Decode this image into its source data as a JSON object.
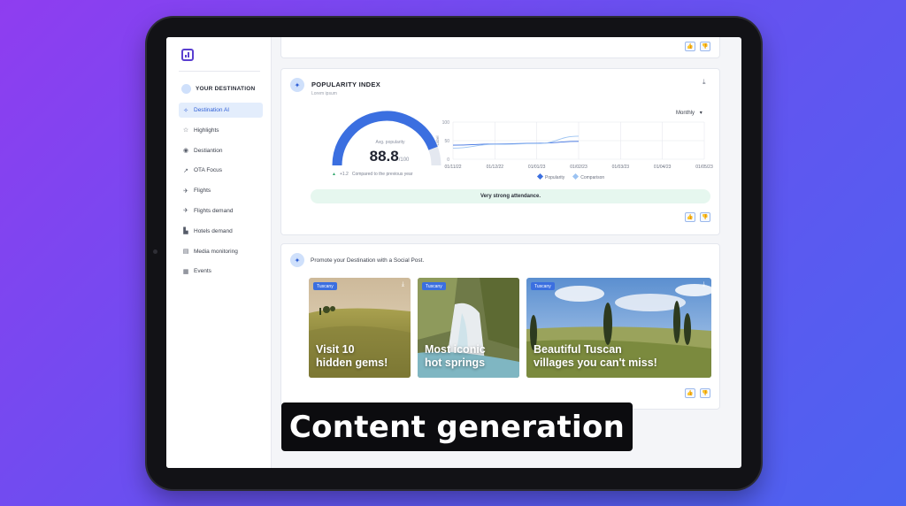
{
  "sidebar": {
    "section_title": "YOUR DESTINATION",
    "items": [
      {
        "label": "Destination AI",
        "icon": "sparkle-icon",
        "glyph": "✧",
        "active": true
      },
      {
        "label": "Highlights",
        "icon": "star-icon",
        "glyph": "☆",
        "active": false
      },
      {
        "label": "Destiantion",
        "icon": "target-icon",
        "glyph": "◉",
        "active": false
      },
      {
        "label": "OTA Focus",
        "icon": "trend-icon",
        "glyph": "↗",
        "active": false
      },
      {
        "label": "Flights",
        "icon": "plane-icon",
        "glyph": "✈",
        "active": false
      },
      {
        "label": "Flights demand",
        "icon": "plane-demand-icon",
        "glyph": "✈",
        "active": false
      },
      {
        "label": "Hotels demand",
        "icon": "hotel-icon",
        "glyph": "▙",
        "active": false
      },
      {
        "label": "Media monitoring",
        "icon": "newspaper-icon",
        "glyph": "▤",
        "active": false
      },
      {
        "label": "Events",
        "icon": "calendar-icon",
        "glyph": "▦",
        "active": false
      }
    ]
  },
  "popularity": {
    "title": "POPULARITY INDEX",
    "subtitle": "Lorem ipsum",
    "gauge_caption": "Avg. popularity",
    "value": "88.8",
    "value_suffix": "/100",
    "gauge_level": 0.888,
    "compare_delta": "+1.2",
    "compare_text": "Compared to the previous year",
    "period_select": "Monthly",
    "banner": "Very strong attendance.",
    "accent": "#3b6fe0"
  },
  "promo": {
    "text": "Promote your Destination with a Social Post.",
    "posts": [
      {
        "tag": "Tuscany",
        "headline": "Visit 10\nhidden gems!"
      },
      {
        "tag": "Tuscany",
        "headline": "Most iconic\nhot springs"
      },
      {
        "tag": "Tuscany",
        "headline": "Beautiful Tuscan\nvillages you can't miss!"
      }
    ]
  },
  "caption": "Content generation",
  "chart_data": {
    "type": "line",
    "title": "",
    "xlabel": "",
    "ylabel": "Label",
    "ylim": [
      0,
      100
    ],
    "yticks": [
      "100",
      "50",
      "0"
    ],
    "categories": [
      "01/11/22",
      "01/12/22",
      "01/01/23",
      "01/02/23",
      "01/03/23",
      "01/04/23",
      "01/05/23"
    ],
    "series": [
      {
        "name": "Popularity",
        "color": "#3b6fe0",
        "values": [
          38,
          41,
          43,
          48,
          null,
          null,
          null
        ]
      },
      {
        "name": "Comparison",
        "color": "#9cc3f2",
        "values": [
          30,
          40,
          42,
          62,
          null,
          null,
          null
        ]
      }
    ],
    "grid": true,
    "legend_position": "bottom"
  }
}
